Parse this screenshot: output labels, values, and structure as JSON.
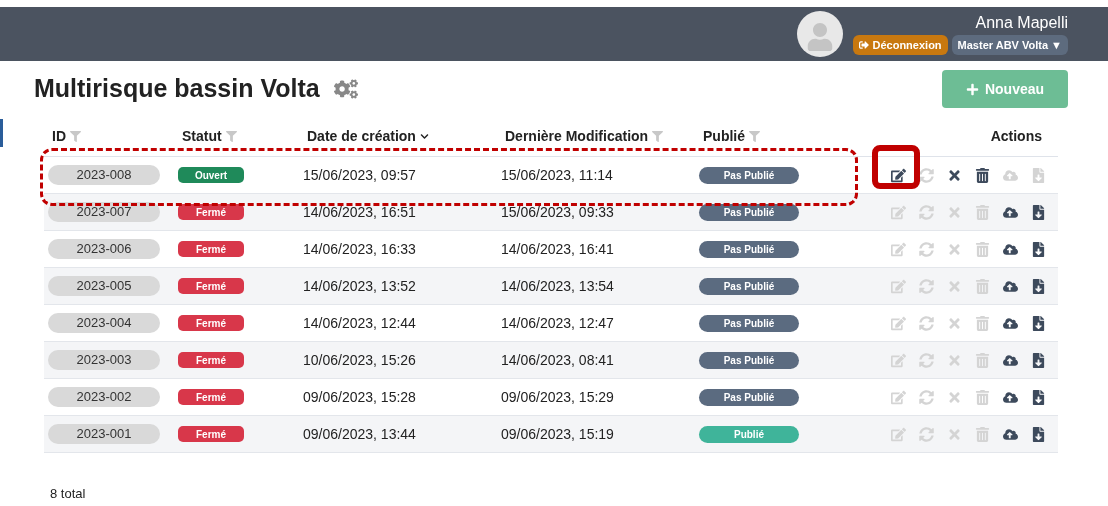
{
  "header": {
    "user_name": "Anna Mapelli",
    "logout": "Déconnexion",
    "account_menu": "Master ABV Volta ▼"
  },
  "page": {
    "title": "Multirisque bassin Volta",
    "new_button": "Nouveau"
  },
  "table": {
    "columns": [
      {
        "label": "ID",
        "filter": true,
        "sort": false
      },
      {
        "label": "Statut",
        "filter": true,
        "sort": false
      },
      {
        "label": "Date de création",
        "filter": false,
        "sort": true
      },
      {
        "label": "Dernière Modification",
        "filter": true,
        "sort": false
      },
      {
        "label": "Publié",
        "filter": true,
        "sort": false
      },
      {
        "label": "Actions",
        "filter": false,
        "sort": false
      }
    ],
    "rows": [
      {
        "id": "2023-008",
        "status": {
          "label": "Ouvert",
          "color": "#1f8a5a"
        },
        "created": "15/06/2023, 09:57",
        "modified": "15/06/2023, 11:14",
        "published_label": "Pas Publié",
        "published": false,
        "highlighted": true,
        "actions": [
          {
            "kind": "edit",
            "disabled": false
          },
          {
            "kind": "refresh",
            "disabled": true
          },
          {
            "kind": "close",
            "disabled": false
          },
          {
            "kind": "delete",
            "disabled": false
          },
          {
            "kind": "upload",
            "disabled": true
          },
          {
            "kind": "download",
            "disabled": true
          }
        ]
      },
      {
        "id": "2023-007",
        "status": {
          "label": "Fermé",
          "color": "#d8374a"
        },
        "created": "14/06/2023, 16:51",
        "modified": "15/06/2023, 09:33",
        "published_label": "Pas Publié",
        "published": false,
        "highlighted": false,
        "actions": [
          {
            "kind": "edit",
            "disabled": true
          },
          {
            "kind": "refresh",
            "disabled": true
          },
          {
            "kind": "close",
            "disabled": true
          },
          {
            "kind": "delete",
            "disabled": true
          },
          {
            "kind": "upload",
            "disabled": false
          },
          {
            "kind": "download",
            "disabled": false
          }
        ]
      },
      {
        "id": "2023-006",
        "status": {
          "label": "Fermé",
          "color": "#d8374a"
        },
        "created": "14/06/2023, 16:33",
        "modified": "14/06/2023, 16:41",
        "published_label": "Pas Publié",
        "published": false,
        "highlighted": false,
        "actions": [
          {
            "kind": "edit",
            "disabled": true
          },
          {
            "kind": "refresh",
            "disabled": true
          },
          {
            "kind": "close",
            "disabled": true
          },
          {
            "kind": "delete",
            "disabled": true
          },
          {
            "kind": "upload",
            "disabled": false
          },
          {
            "kind": "download",
            "disabled": false
          }
        ]
      },
      {
        "id": "2023-005",
        "status": {
          "label": "Fermé",
          "color": "#d8374a"
        },
        "created": "14/06/2023, 13:52",
        "modified": "14/06/2023, 13:54",
        "published_label": "Pas Publié",
        "published": false,
        "highlighted": false,
        "actions": [
          {
            "kind": "edit",
            "disabled": true
          },
          {
            "kind": "refresh",
            "disabled": true
          },
          {
            "kind": "close",
            "disabled": true
          },
          {
            "kind": "delete",
            "disabled": true
          },
          {
            "kind": "upload",
            "disabled": false
          },
          {
            "kind": "download",
            "disabled": false
          }
        ]
      },
      {
        "id": "2023-004",
        "status": {
          "label": "Fermé",
          "color": "#d8374a"
        },
        "created": "14/06/2023, 12:44",
        "modified": "14/06/2023, 12:47",
        "published_label": "Pas Publié",
        "published": false,
        "highlighted": false,
        "actions": [
          {
            "kind": "edit",
            "disabled": true
          },
          {
            "kind": "refresh",
            "disabled": true
          },
          {
            "kind": "close",
            "disabled": true
          },
          {
            "kind": "delete",
            "disabled": true
          },
          {
            "kind": "upload",
            "disabled": false
          },
          {
            "kind": "download",
            "disabled": false
          }
        ]
      },
      {
        "id": "2023-003",
        "status": {
          "label": "Fermé",
          "color": "#d8374a"
        },
        "created": "10/06/2023, 15:26",
        "modified": "14/06/2023, 08:41",
        "published_label": "Pas Publié",
        "published": false,
        "highlighted": false,
        "actions": [
          {
            "kind": "edit",
            "disabled": true
          },
          {
            "kind": "refresh",
            "disabled": true
          },
          {
            "kind": "close",
            "disabled": true
          },
          {
            "kind": "delete",
            "disabled": true
          },
          {
            "kind": "upload",
            "disabled": false
          },
          {
            "kind": "download",
            "disabled": false
          }
        ]
      },
      {
        "id": "2023-002",
        "status": {
          "label": "Fermé",
          "color": "#d8374a"
        },
        "created": "09/06/2023, 15:28",
        "modified": "09/06/2023, 15:29",
        "published_label": "Pas Publié",
        "published": false,
        "highlighted": false,
        "actions": [
          {
            "kind": "edit",
            "disabled": true
          },
          {
            "kind": "refresh",
            "disabled": true
          },
          {
            "kind": "close",
            "disabled": true
          },
          {
            "kind": "delete",
            "disabled": true
          },
          {
            "kind": "upload",
            "disabled": false
          },
          {
            "kind": "download",
            "disabled": false
          }
        ]
      },
      {
        "id": "2023-001",
        "status": {
          "label": "Fermé",
          "color": "#d8374a"
        },
        "created": "09/06/2023, 13:44",
        "modified": "09/06/2023, 15:19",
        "published_label": "Publié",
        "published": true,
        "highlighted": false,
        "actions": [
          {
            "kind": "edit",
            "disabled": true
          },
          {
            "kind": "refresh",
            "disabled": true
          },
          {
            "kind": "close",
            "disabled": true
          },
          {
            "kind": "delete",
            "disabled": true
          },
          {
            "kind": "upload",
            "disabled": false
          },
          {
            "kind": "download",
            "disabled": false
          }
        ]
      }
    ],
    "total": "8 total"
  }
}
